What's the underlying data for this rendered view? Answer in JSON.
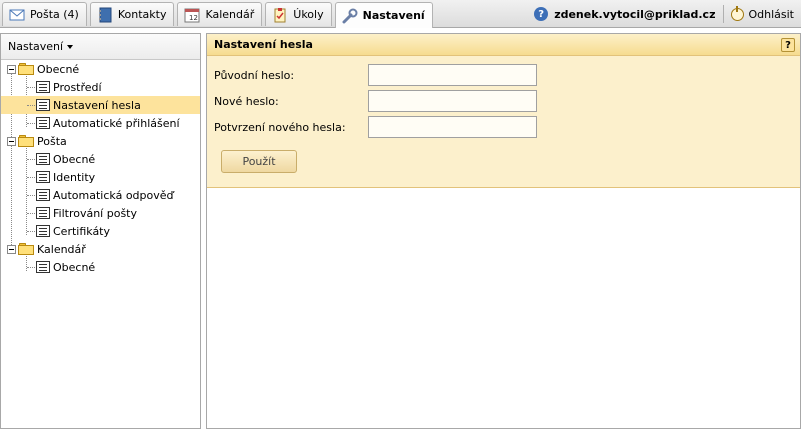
{
  "tabs": [
    {
      "label": "Pošta (4)",
      "icon": "mail-icon"
    },
    {
      "label": "Kontakty",
      "icon": "address-book-icon"
    },
    {
      "label": "Kalendář",
      "icon": "calendar-icon"
    },
    {
      "label": "Úkoly",
      "icon": "tasks-icon"
    },
    {
      "label": "Nastavení",
      "icon": "wrench-icon",
      "active": true
    }
  ],
  "user": {
    "email": "zdenek.vytocil@priklad.cz",
    "logout_label": "Odhlásit",
    "help_glyph": "?"
  },
  "sidebar": {
    "title": "Nastavení",
    "groups": [
      {
        "label": "Obecné",
        "items": [
          "Prostředí",
          "Nastavení hesla",
          "Automatické přihlášení"
        ]
      },
      {
        "label": "Pošta",
        "items": [
          "Obecné",
          "Identity",
          "Automatická odpověď",
          "Filtrování pošty",
          "Certifikáty"
        ]
      },
      {
        "label": "Kalendář",
        "items": [
          "Obecné"
        ]
      }
    ],
    "selected": "Nastavení hesla"
  },
  "password_form": {
    "title": "Nastavení hesla",
    "help_label": "?",
    "old_label": "Původní heslo:",
    "new_label": "Nové heslo:",
    "confirm_label": "Potvrzení nového hesla:",
    "old_value": "",
    "new_value": "",
    "confirm_value": "",
    "submit_label": "Použít"
  },
  "colors": {
    "accent": "#fde39c",
    "panel": "#fcf0cc",
    "header": "#f6dc8f"
  }
}
